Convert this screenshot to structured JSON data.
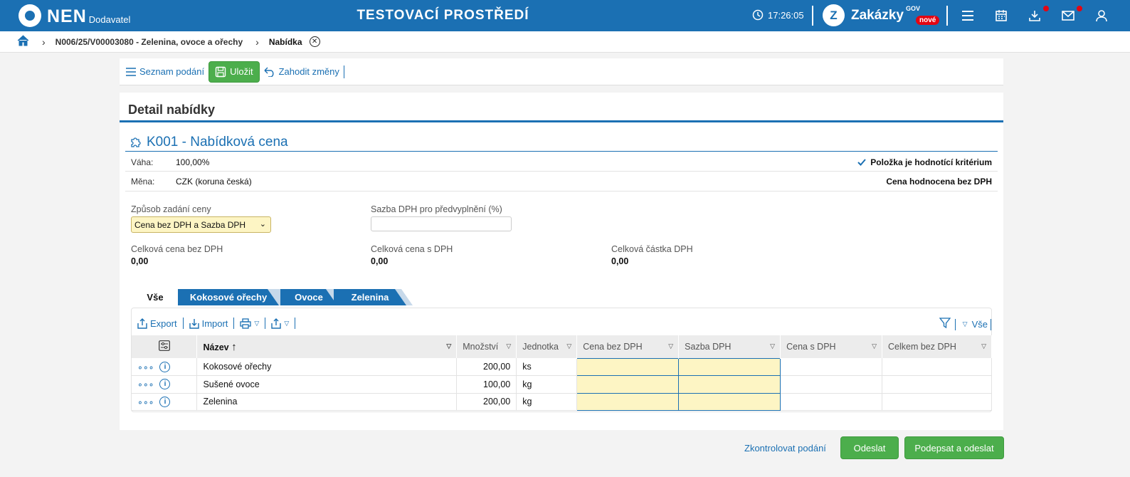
{
  "header": {
    "logo_text": "NEN",
    "logo_sub": "Dodavatel",
    "env_title": "TESTOVACÍ PROSTŘEDÍ",
    "time": "17:26:05",
    "zakazky": "Zakázky",
    "zakazky_gov": "GOV",
    "zakazky_badge": "nové",
    "zakazky_icon": "Z"
  },
  "breadcrumb": {
    "item1": "N006/25/V00003080 - Zelenina, ovoce a ořechy",
    "item2": "Nabídka"
  },
  "toolbar": {
    "list_label": "Seznam podání",
    "save_label": "Uložit",
    "discard_label": "Zahodit změny"
  },
  "detail": {
    "title": "Detail nabídky",
    "criterion_title": "K001 - Nabídková cena",
    "weight_label": "Váha:",
    "weight_value": "100,00%",
    "currency_label": "Měna:",
    "currency_value": "CZK (koruna česká)",
    "criterion_flag": "Položka je hodnotící kritérium",
    "evaluated": "Cena hodnocena bez DPH",
    "price_mode_label": "Způsob zadání ceny",
    "price_mode_value": "Cena bez DPH a Sazba DPH",
    "vat_rate_label": "Sazba DPH pro předvyplnění (%)",
    "vat_rate_value": "",
    "total_no_vat_label": "Celková cena bez DPH",
    "total_no_vat_value": "0,00",
    "total_vat_label": "Celková cena s DPH",
    "total_vat_value": "0,00",
    "vat_amount_label": "Celková částka DPH",
    "vat_amount_value": "0,00"
  },
  "tabs": [
    "Vše",
    "Kokosové ořechy",
    "Ovoce",
    "Zelenina"
  ],
  "grid": {
    "export": "Export",
    "import": "Import",
    "filter_all": "Vše",
    "columns": [
      "Název",
      "Množství",
      "Jednotka",
      "Cena bez DPH",
      "Sazba DPH",
      "Cena s DPH",
      "Celkem bez DPH"
    ],
    "rows": [
      {
        "name": "Kokosové ořechy",
        "qty": "200,00",
        "unit": "ks"
      },
      {
        "name": "Sušené ovoce",
        "qty": "100,00",
        "unit": "kg"
      },
      {
        "name": "Zelenina",
        "qty": "200,00",
        "unit": "kg"
      }
    ]
  },
  "footer": {
    "check": "Zkontrolovat podání",
    "send": "Odeslat",
    "sign_send": "Podepsat a odeslat"
  },
  "colors": {
    "brand_blue": "#1b70b3",
    "green": "#4cae4c",
    "field_yellow": "#fdf5c4",
    "badge_red": "#e30613"
  }
}
